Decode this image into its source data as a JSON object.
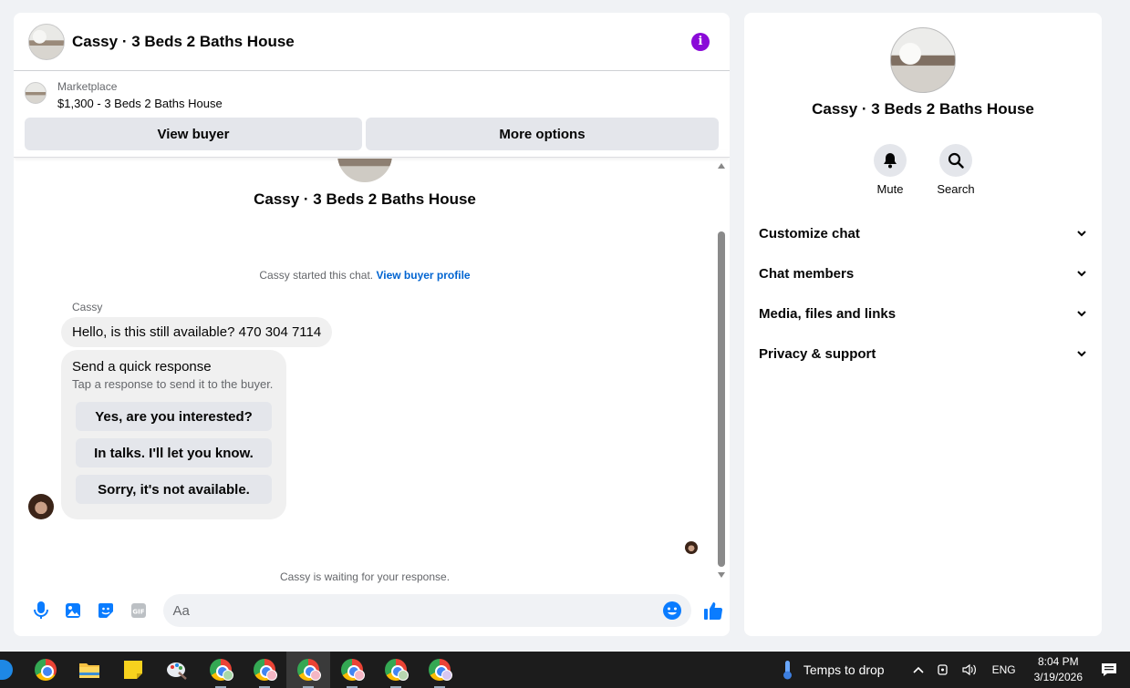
{
  "chat": {
    "title": "Cassy · 3 Beds 2 Baths House",
    "marketplace_label": "Marketplace",
    "listing": "$1,300 - 3 Beds 2 Baths House",
    "view_buyer": "View buyer",
    "more_options": "More options",
    "conv_name": "Cassy · 3 Beds 2 Baths House",
    "started_text": "Cassy started this chat. ",
    "view_buyer_profile": "View buyer profile",
    "sender": "Cassy",
    "message": "Hello, is this still available? 470 304 7114",
    "quick_title": "Send a quick response",
    "quick_sub": "Tap a response to send it to the buyer.",
    "quick_replies": [
      "Yes, are you interested?",
      "In talks. I'll let you know.",
      "Sorry, it's not available."
    ],
    "waiting": "Cassy is waiting for your response.",
    "input_placeholder": "Aa"
  },
  "side": {
    "name": "Cassy · 3 Beds 2 Baths House",
    "mute": "Mute",
    "search": "Search",
    "items": [
      "Customize chat",
      "Chat members",
      "Media, files and links",
      "Privacy & support"
    ]
  },
  "taskbar": {
    "weather": "Temps to drop",
    "lang": "ENG",
    "time": "8:04 PM",
    "date": "3/19/2026"
  },
  "colors": {
    "accent_blue": "#0064d1",
    "messenger_blue": "#0a7cff",
    "info_purple": "#8a0ad8"
  }
}
